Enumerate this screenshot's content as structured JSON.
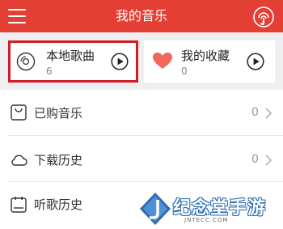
{
  "header": {
    "title": "我的音乐"
  },
  "cards": {
    "local": {
      "title": "本地歌曲",
      "count": "6"
    },
    "favorites": {
      "title": "我的收藏",
      "count": "0"
    }
  },
  "list": [
    {
      "label": "已购音乐",
      "count": "0",
      "icon": "bag-icon"
    },
    {
      "label": "下载历史",
      "count": "0",
      "icon": "cloud-icon"
    },
    {
      "label": "听歌历史",
      "count": "",
      "icon": "calendar-icon"
    }
  ],
  "colors": {
    "header": "#e33f34",
    "highlight_border": "#d21b24",
    "heart": "#f0685c",
    "watermark_blue": "#2d6db2"
  },
  "watermark": {
    "brand": "纪念堂手游",
    "domain": "JNTECC.COM"
  }
}
